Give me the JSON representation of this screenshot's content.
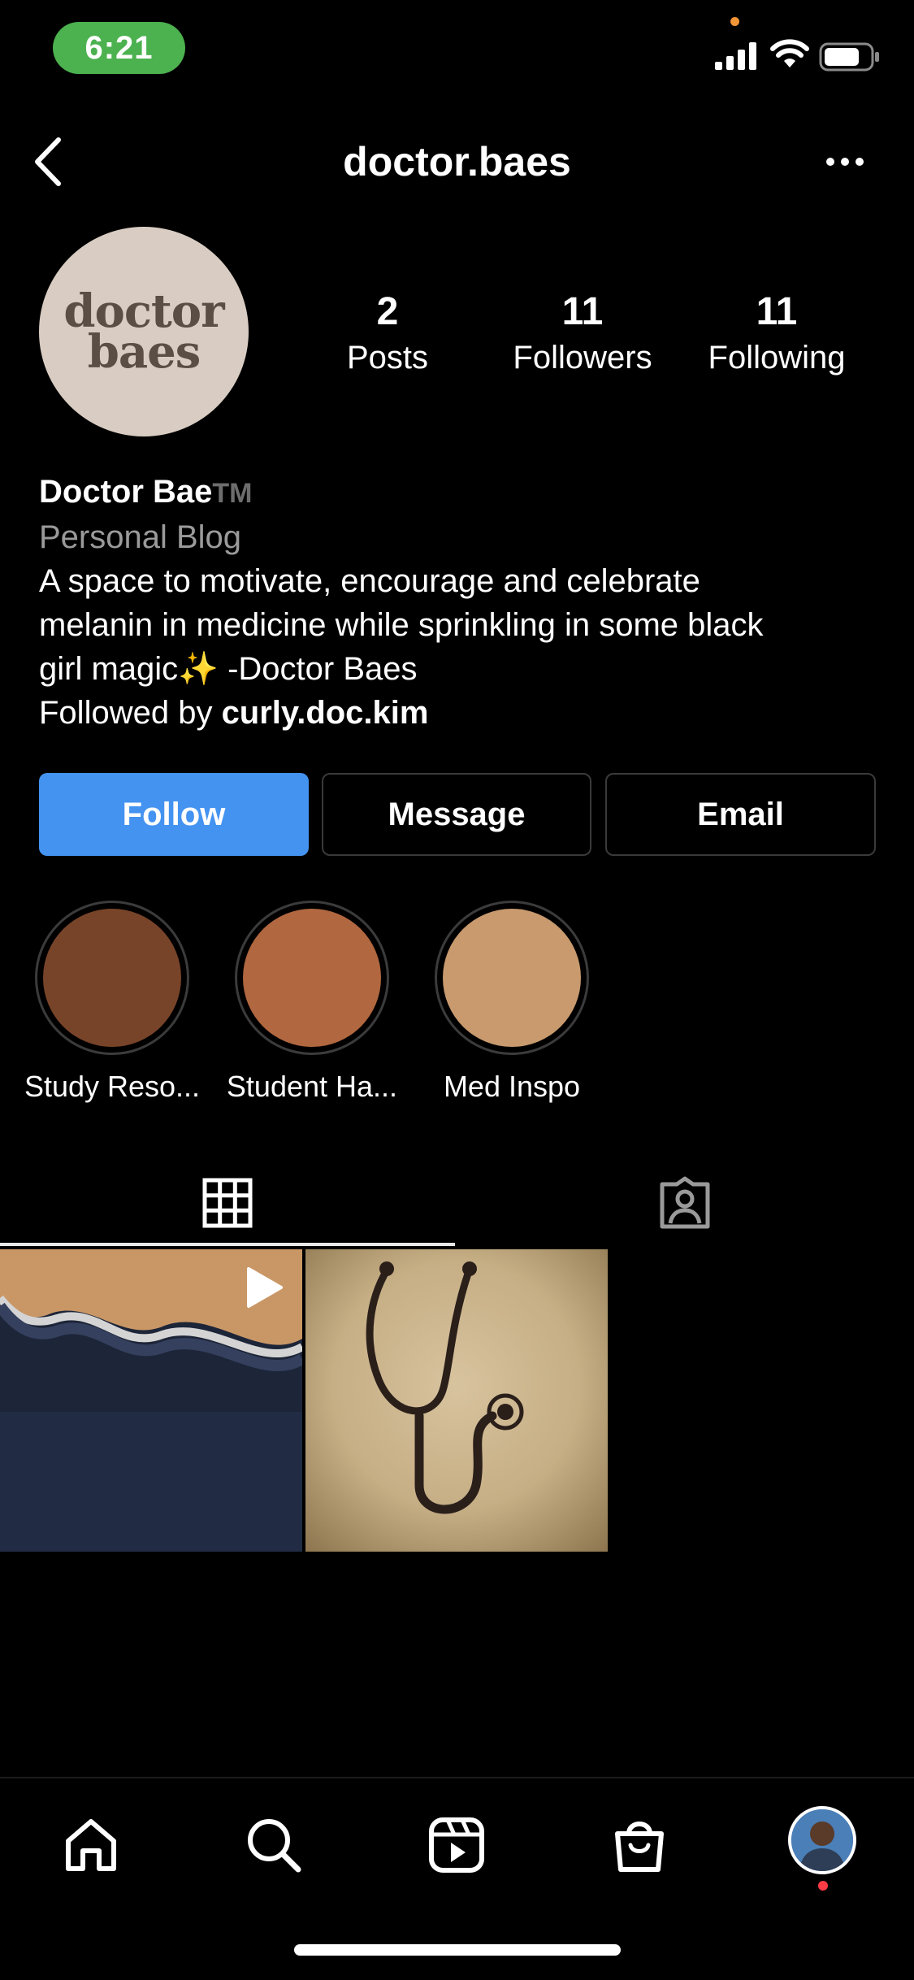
{
  "status_bar": {
    "time": "6:21"
  },
  "header": {
    "username": "doctor.baes"
  },
  "profile": {
    "avatar_logo_line1": "doctor",
    "avatar_logo_line2": "baes",
    "stats": [
      {
        "value": "2",
        "label": "Posts"
      },
      {
        "value": "11",
        "label": "Followers"
      },
      {
        "value": "11",
        "label": "Following"
      }
    ],
    "name": "Doctor Bae",
    "name_mark": "TM",
    "category": "Personal Blog",
    "bio_line1": "A space to motivate, encourage and celebrate",
    "bio_line2": "melanin in medicine while sprinkling in some black",
    "bio_line3_before": "girl magic",
    "bio_line3_emoji": "✨",
    "bio_line3_after": " -Doctor Baes",
    "followed_by_prefix": "Followed by ",
    "followed_by_user": "curly.doc.kim"
  },
  "actions": {
    "follow": "Follow",
    "message": "Message",
    "email": "Email"
  },
  "highlights": [
    {
      "label": "Study Reso...",
      "color": "#784429"
    },
    {
      "label": "Student Ha...",
      "color": "#b1673f"
    },
    {
      "label": "Med Inspo",
      "color": "#c89a6e"
    }
  ],
  "colors": {
    "follow_button": "#4493f0",
    "time_pill": "#4cb14f",
    "notification": "#ff3b45"
  },
  "icons": {
    "tab_grid": "grid-icon",
    "tab_tagged": "tagged-user-icon",
    "nav": [
      "home-icon",
      "search-icon",
      "reels-icon",
      "shop-icon",
      "profile-avatar"
    ]
  }
}
